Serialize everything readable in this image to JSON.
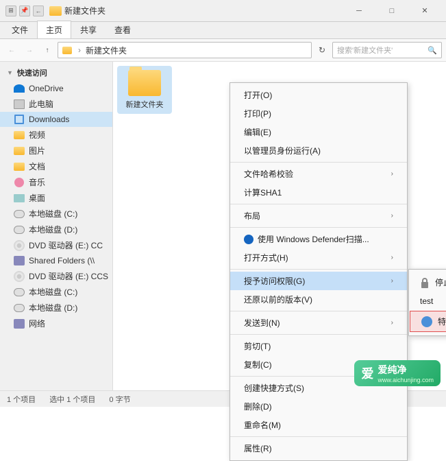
{
  "titlebar": {
    "title": "新建文件夹",
    "minimize_label": "─",
    "maximize_label": "□",
    "close_label": "✕"
  },
  "ribbon": {
    "tabs": [
      "文件",
      "主页",
      "共享",
      "查看"
    ]
  },
  "addressbar": {
    "path_folder": "新建文件夹",
    "search_placeholder": "搜索'新建文件夹'"
  },
  "sidebar": {
    "quick_access": "快速访问",
    "items": [
      {
        "label": "OneDrive"
      },
      {
        "label": "此电脑"
      },
      {
        "label": "Downloads"
      },
      {
        "label": "视频"
      },
      {
        "label": "图片"
      },
      {
        "label": "文档"
      },
      {
        "label": "音乐"
      },
      {
        "label": "桌面"
      },
      {
        "label": "本地磁盘 (C:)"
      },
      {
        "label": "本地磁盘 (D:)"
      },
      {
        "label": "DVD 驱动器 (E:) CC"
      },
      {
        "label": "Shared Folders (\\\\"
      },
      {
        "label": "DVD 驱动器 (E:) CCS"
      },
      {
        "label": "本地磁盘 (C:)"
      },
      {
        "label": "本地磁盘 (D:)"
      },
      {
        "label": "网络"
      }
    ]
  },
  "file_area": {
    "folder_name": "新建文件夹"
  },
  "context_menu": {
    "items": [
      {
        "label": "打开(O)",
        "has_sub": false
      },
      {
        "label": "打印(P)",
        "has_sub": false
      },
      {
        "label": "编辑(E)",
        "has_sub": false
      },
      {
        "label": "以管理员身份运行(A)",
        "has_sub": false
      },
      {
        "separator": true
      },
      {
        "label": "文件哈希校验",
        "has_sub": true
      },
      {
        "label": "计算SHA1",
        "has_sub": false
      },
      {
        "separator": true
      },
      {
        "label": "布局",
        "has_sub": true
      },
      {
        "separator": true
      },
      {
        "label": "使用 Windows Defender扫描...",
        "has_sub": false,
        "has_icon": "defender"
      },
      {
        "label": "打开方式(H)",
        "has_sub": true
      },
      {
        "separator": true
      },
      {
        "label": "授予访问权限(G)",
        "has_sub": true,
        "highlighted": true
      },
      {
        "label": "还原以前的版本(V)",
        "has_sub": false
      },
      {
        "separator": true
      },
      {
        "label": "发送到(N)",
        "has_sub": true
      },
      {
        "separator": true
      },
      {
        "label": "剪切(T)",
        "has_sub": false
      },
      {
        "label": "复制(C)",
        "has_sub": false
      },
      {
        "separator": true
      },
      {
        "label": "创建快捷方式(S)",
        "has_sub": false
      },
      {
        "label": "删除(D)",
        "has_sub": false
      },
      {
        "label": "重命名(M)",
        "has_sub": false
      },
      {
        "separator": true
      },
      {
        "label": "属性(R)",
        "has_sub": false
      }
    ],
    "submenu": {
      "stop_sharing": "停止共享",
      "test_label": "test",
      "specific_user": "特定用户..."
    }
  },
  "statusbar": {
    "count": "1 个项目",
    "selected": "选中 1 个项目",
    "size": "0 字节"
  },
  "watermark": {
    "logo_text": "爱",
    "main_text": "爱纯净",
    "sub_text": "www.aichunjing.com"
  }
}
